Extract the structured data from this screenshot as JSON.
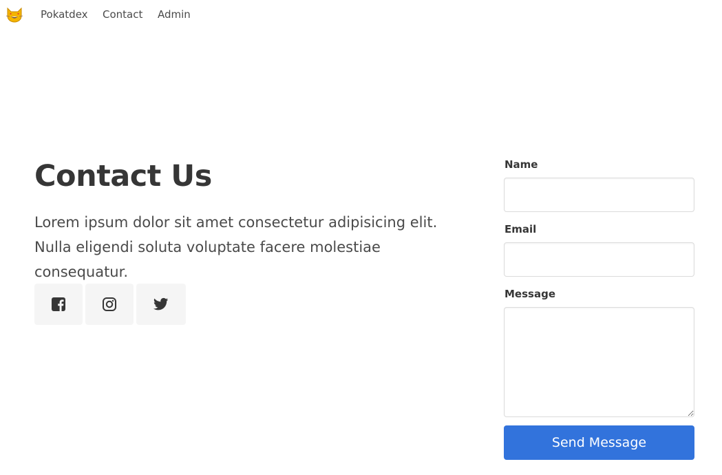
{
  "navbar": {
    "logo_icon": "smiling-cat-face-with-heart-eyes-icon",
    "links": [
      {
        "label": "Pokatdex"
      },
      {
        "label": "Contact"
      },
      {
        "label": "Admin"
      }
    ]
  },
  "hero": {
    "title": "Contact Us",
    "description": "Lorem ipsum dolor sit amet consectetur adipisicing elit. Nulla eligendi soluta voluptate facere molestiae consequatur."
  },
  "social": [
    {
      "icon": "facebook-icon"
    },
    {
      "icon": "instagram-icon"
    },
    {
      "icon": "twitter-icon"
    }
  ],
  "form": {
    "name_label": "Name",
    "name_value": "",
    "email_label": "Email",
    "email_value": "",
    "message_label": "Message",
    "message_value": "",
    "submit_label": "Send Message"
  },
  "colors": {
    "primary": "#3273dc",
    "text": "#363636",
    "social_bg": "#f5f5f5",
    "border": "#dbdbdb"
  }
}
